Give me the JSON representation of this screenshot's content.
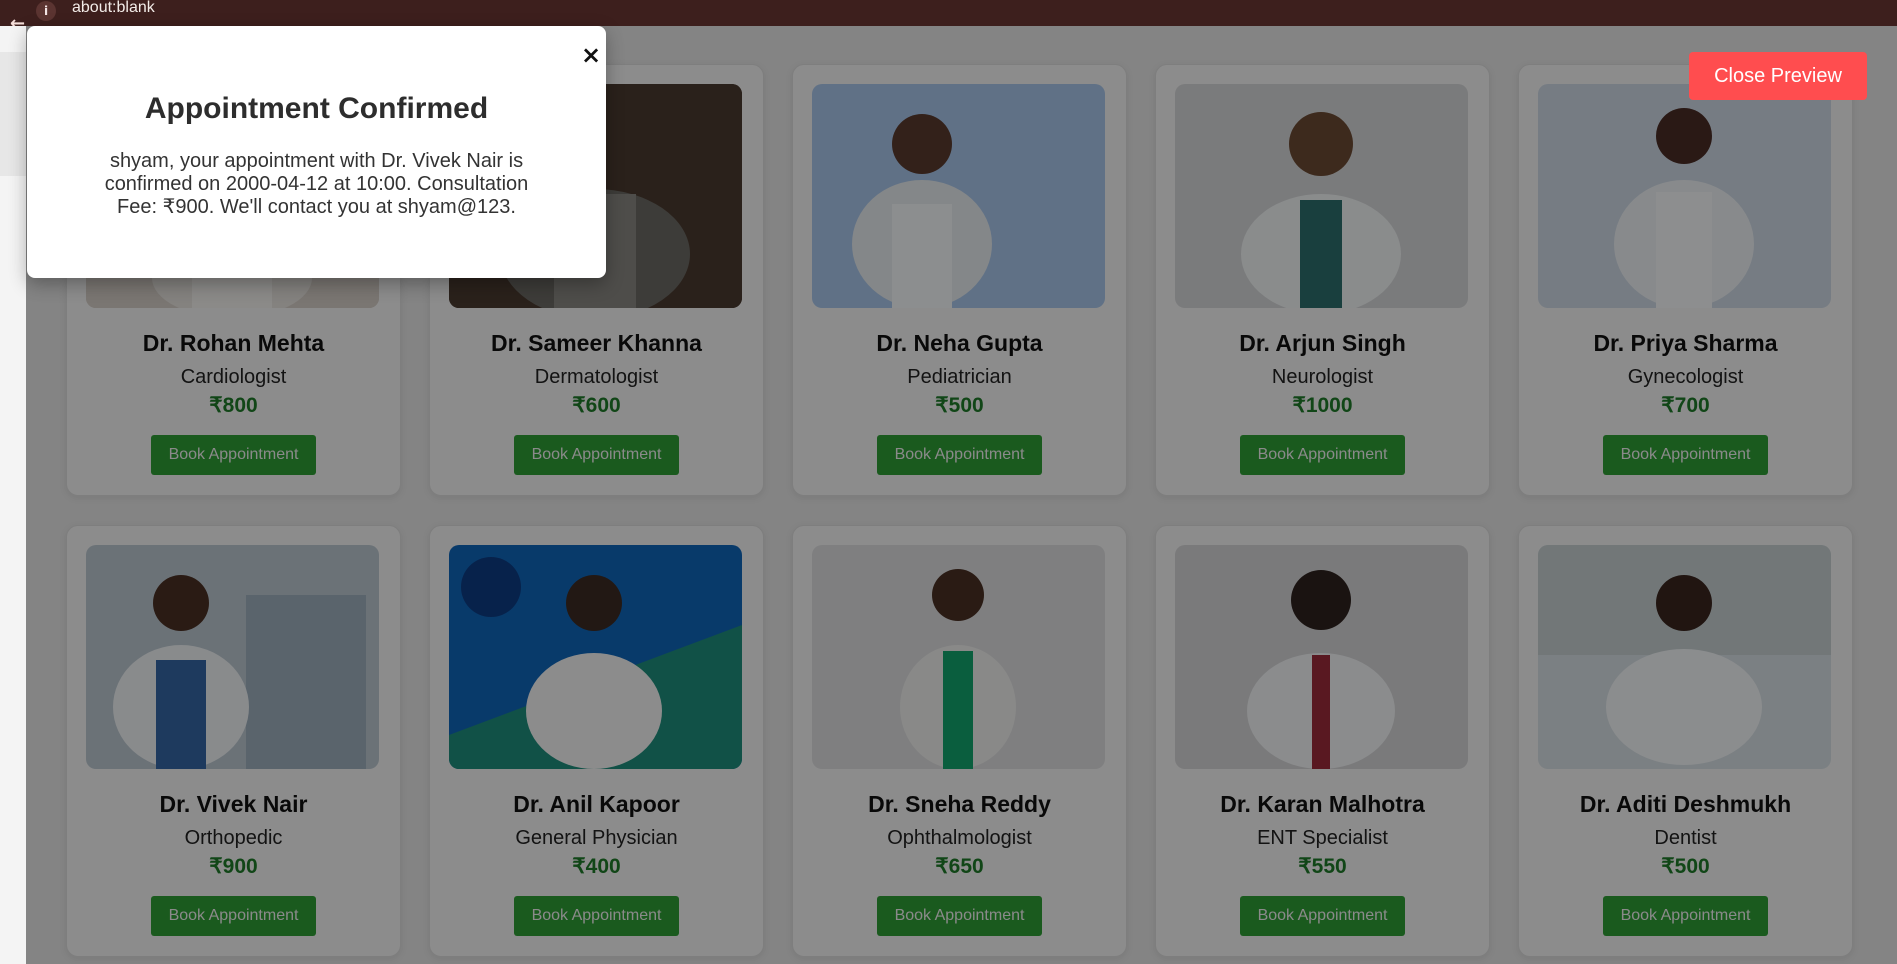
{
  "browser": {
    "url_text": "about:blank"
  },
  "doctors": [
    {
      "name": "Dr. Rohan Mehta",
      "specialty": "Cardiologist",
      "fee": "₹800",
      "action": "Book Appointment"
    },
    {
      "name": "Dr. Sameer Khanna",
      "specialty": "Dermatologist",
      "fee": "₹600",
      "action": "Book Appointment"
    },
    {
      "name": "Dr. Neha Gupta",
      "specialty": "Pediatrician",
      "fee": "₹500",
      "action": "Book Appointment"
    },
    {
      "name": "Dr. Arjun Singh",
      "specialty": "Neurologist",
      "fee": "₹1000",
      "action": "Book Appointment"
    },
    {
      "name": "Dr. Priya Sharma",
      "specialty": "Gynecologist",
      "fee": "₹700",
      "action": "Book Appointment"
    },
    {
      "name": "Dr. Vivek Nair",
      "specialty": "Orthopedic",
      "fee": "₹900",
      "action": "Book Appointment"
    },
    {
      "name": "Dr. Anil Kapoor",
      "specialty": "General Physician",
      "fee": "₹400",
      "action": "Book Appointment"
    },
    {
      "name": "Dr. Sneha Reddy",
      "specialty": "Ophthalmologist",
      "fee": "₹650",
      "action": "Book Appointment"
    },
    {
      "name": "Dr. Karan Malhotra",
      "specialty": "ENT Specialist",
      "fee": "₹550",
      "action": "Book Appointment"
    },
    {
      "name": "Dr. Aditi Deshmukh",
      "specialty": "Dentist",
      "fee": "₹500",
      "action": "Book Appointment"
    }
  ],
  "modal": {
    "title": "Appointment Confirmed",
    "message": "shyam, your appointment with Dr. Vivek Nair is confirmed on 2000-04-12 at 10:00. Consultation Fee: ₹900. We'll contact you at shyam@123.",
    "close_symbol": "×"
  },
  "close_preview_label": "Close Preview",
  "colors": {
    "accent_green": "#2f9f35",
    "fee_green": "#1f7b2a",
    "close_red": "#ff4d4f",
    "topbar": "#3d1f1d"
  },
  "icons": {
    "back": "back-arrow-icon",
    "info": "info-icon",
    "close": "close-icon"
  }
}
